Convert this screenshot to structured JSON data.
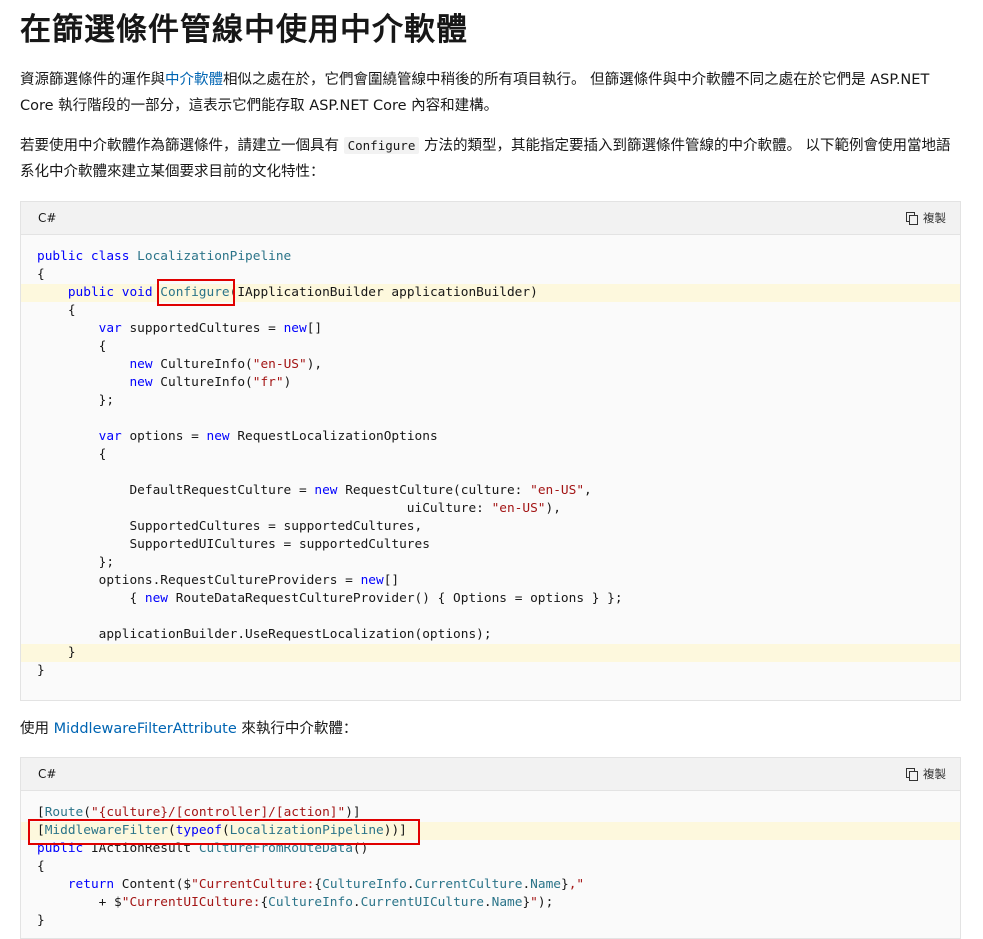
{
  "title": "在篩選條件管線中使用中介軟體",
  "para1": {
    "before": "資源篩選條件的運作與",
    "link": "中介軟體",
    "after": "相似之處在於，它們會圍繞管線中稍後的所有項目執行。 但篩選條件與中介軟體不同之處在於它們是 ASP.NET Core 執行階段的一部分，這表示它們能存取 ASP.NET Core 內容和建構。"
  },
  "para2": {
    "before": "若要使用中介軟體作為篩選條件，請建立一個具有 ",
    "code": "Configure",
    "after": " 方法的類型，其能指定要插入到篩選條件管線的中介軟體。 以下範例會使用當地語系化中介軟體來建立某個要求目前的文化特性："
  },
  "para3": {
    "before": "使用 ",
    "link": "MiddlewareFilterAttribute",
    "after": " 來執行中介軟體："
  },
  "code_block_1": {
    "lang": "C#",
    "copy_label": "複製",
    "lines": [
      [
        {
          "t": "public class ",
          "c": "kw"
        },
        {
          "t": "LocalizationPipeline",
          "c": "ty"
        }
      ],
      [
        {
          "t": "{"
        }
      ],
      [
        {
          "t": "    "
        },
        {
          "t": "public void ",
          "c": "kw"
        },
        {
          "t": "Configure",
          "c": "ty"
        },
        {
          "t": "(IApplicationBuilder applicationBuilder)"
        }
      ],
      [
        {
          "t": "    {"
        }
      ],
      [
        {
          "t": "        "
        },
        {
          "t": "var",
          "c": "kw"
        },
        {
          "t": " supportedCultures = "
        },
        {
          "t": "new",
          "c": "kw"
        },
        {
          "t": "[]"
        }
      ],
      [
        {
          "t": "        {"
        }
      ],
      [
        {
          "t": "            "
        },
        {
          "t": "new",
          "c": "kw"
        },
        {
          "t": " CultureInfo("
        },
        {
          "t": "\"en-US\"",
          "c": "str"
        },
        {
          "t": "),"
        }
      ],
      [
        {
          "t": "            "
        },
        {
          "t": "new",
          "c": "kw"
        },
        {
          "t": " CultureInfo("
        },
        {
          "t": "\"fr\"",
          "c": "str"
        },
        {
          "t": ")"
        }
      ],
      [
        {
          "t": "        };"
        }
      ],
      [
        {
          "t": ""
        }
      ],
      [
        {
          "t": "        "
        },
        {
          "t": "var",
          "c": "kw"
        },
        {
          "t": " options = "
        },
        {
          "t": "new",
          "c": "kw"
        },
        {
          "t": " RequestLocalizationOptions"
        }
      ],
      [
        {
          "t": "        {"
        }
      ],
      [
        {
          "t": ""
        }
      ],
      [
        {
          "t": "            DefaultRequestCulture = "
        },
        {
          "t": "new",
          "c": "kw"
        },
        {
          "t": " RequestCulture(culture: "
        },
        {
          "t": "\"en-US\"",
          "c": "str"
        },
        {
          "t": ","
        }
      ],
      [
        {
          "t": "                                                uiCulture: "
        },
        {
          "t": "\"en-US\"",
          "c": "str"
        },
        {
          "t": "),"
        }
      ],
      [
        {
          "t": "            SupportedCultures = supportedCultures,"
        }
      ],
      [
        {
          "t": "            SupportedUICultures = supportedCultures"
        }
      ],
      [
        {
          "t": "        };"
        }
      ],
      [
        {
          "t": "        options.RequestCultureProviders = "
        },
        {
          "t": "new",
          "c": "kw"
        },
        {
          "t": "[]"
        }
      ],
      [
        {
          "t": "            { "
        },
        {
          "t": "new",
          "c": "kw"
        },
        {
          "t": " RouteDataRequestCultureProvider() { Options = options } };"
        }
      ],
      [
        {
          "t": ""
        }
      ],
      [
        {
          "t": "        applicationBuilder.UseRequestLocalization(options);"
        }
      ],
      [
        {
          "t": "    }"
        }
      ],
      [
        {
          "t": "}"
        }
      ]
    ]
  },
  "code_block_2": {
    "lang": "C#",
    "copy_label": "複製",
    "lines": [
      [
        {
          "t": "["
        },
        {
          "t": "Route",
          "c": "ty"
        },
        {
          "t": "("
        },
        {
          "t": "\"{culture}/[controller]/[action]\"",
          "c": "str"
        },
        {
          "t": ")]"
        }
      ],
      [
        {
          "t": "["
        },
        {
          "t": "MiddlewareFilter",
          "c": "ty"
        },
        {
          "t": "("
        },
        {
          "t": "typeof",
          "c": "kw"
        },
        {
          "t": "("
        },
        {
          "t": "LocalizationPipeline",
          "c": "ty"
        },
        {
          "t": "))]"
        }
      ],
      [
        {
          "t": "public",
          "c": "kw"
        },
        {
          "t": " IActionResult "
        },
        {
          "t": "CultureFromRouteData",
          "c": "ty"
        },
        {
          "t": "()"
        }
      ],
      [
        {
          "t": "{"
        }
      ],
      [
        {
          "t": "    "
        },
        {
          "t": "return",
          "c": "kw"
        },
        {
          "t": " Content($"
        },
        {
          "t": "\"CurrentCulture:",
          "c": "str"
        },
        {
          "t": "{"
        },
        {
          "t": "CultureInfo",
          "c": "ty"
        },
        {
          "t": "."
        },
        {
          "t": "CurrentCulture",
          "c": "ty"
        },
        {
          "t": "."
        },
        {
          "t": "Name",
          "c": "ty"
        },
        {
          "t": "}"
        },
        {
          "t": ",\"",
          "c": "str"
        }
      ],
      [
        {
          "t": "        + $"
        },
        {
          "t": "\"CurrentUICulture:",
          "c": "str"
        },
        {
          "t": "{"
        },
        {
          "t": "CultureInfo",
          "c": "ty"
        },
        {
          "t": "."
        },
        {
          "t": "CurrentUICulture",
          "c": "ty"
        },
        {
          "t": "."
        },
        {
          "t": "Name",
          "c": "ty"
        },
        {
          "t": "}"
        },
        {
          "t": "\"",
          "c": "str"
        },
        {
          "t": ");"
        }
      ],
      [
        {
          "t": "}"
        }
      ]
    ]
  }
}
